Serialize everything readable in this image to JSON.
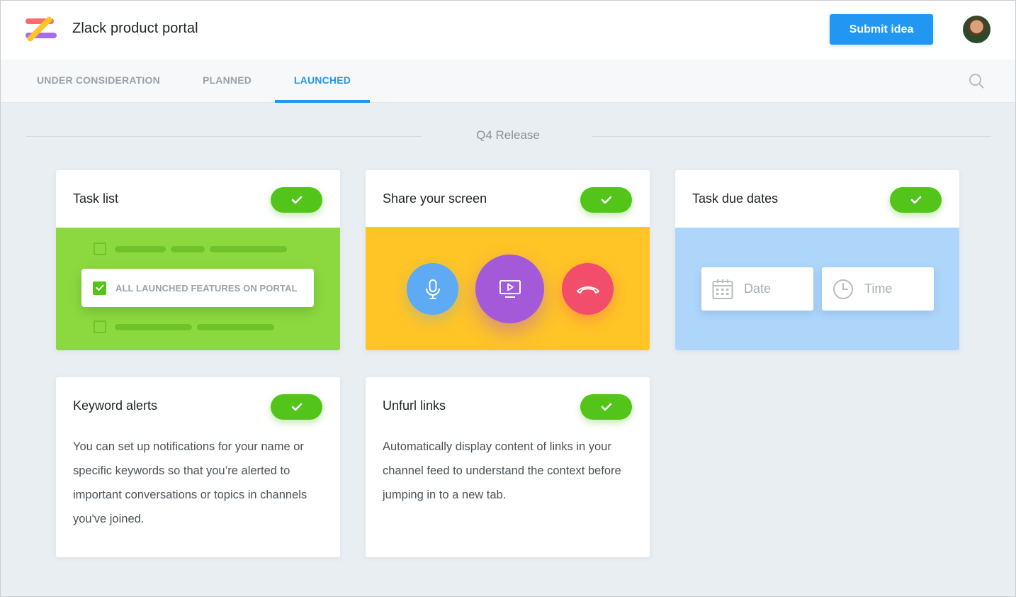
{
  "header": {
    "app_title": "Zlack product portal",
    "submit_label": "Submit idea",
    "brand_color": "#2196f3"
  },
  "tabs": [
    {
      "label": "UNDER CONSIDERATION",
      "active": false
    },
    {
      "label": "PLANNED",
      "active": false
    },
    {
      "label": "LAUNCHED",
      "active": true
    }
  ],
  "section": {
    "title": "Q4 Release"
  },
  "cards": [
    {
      "title": "Task list",
      "status": "launched",
      "body_color": "#8cd93f",
      "highlight_item": "ALL LAUNCHED FEATURES ON PORTAL"
    },
    {
      "title": "Share your screen",
      "status": "launched",
      "body_color": "#ffc426",
      "buttons": [
        "microphone-icon",
        "screen-share-icon",
        "hang-up-icon"
      ]
    },
    {
      "title": "Task due dates",
      "status": "launched",
      "body_color": "#aed6fb",
      "date_placeholder": "Date",
      "time_placeholder": "Time"
    },
    {
      "title": "Keyword alerts",
      "status": "launched",
      "description": "You can set up notifications for your name or specific keywords so that you’re alerted to important conversations or topics in channels you've joined."
    },
    {
      "title": "Unfurl links",
      "status": "launched",
      "description": "Automatically display content of links in your channel feed to understand the context before jumping in to a new tab."
    }
  ]
}
